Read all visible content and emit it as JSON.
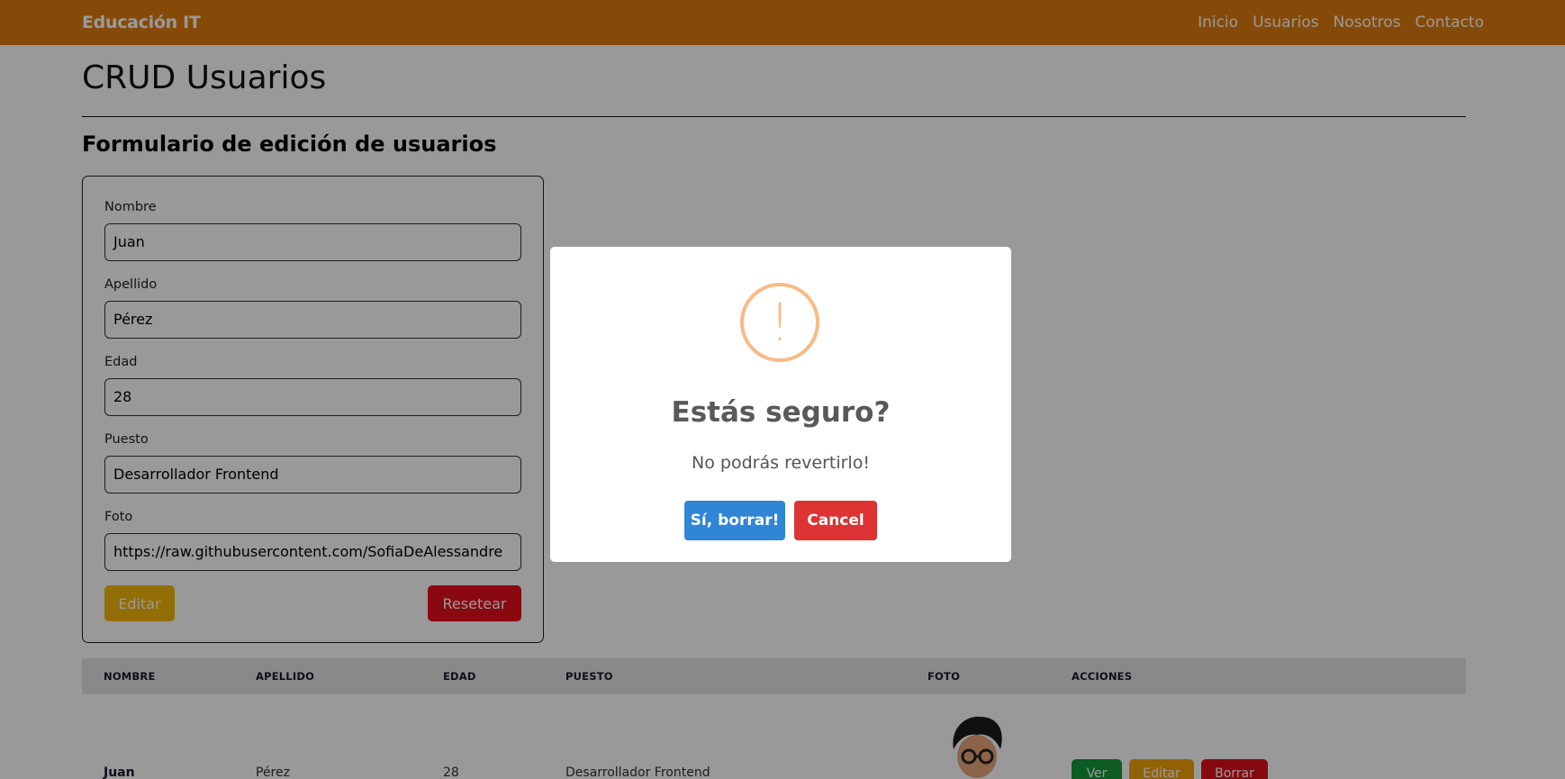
{
  "navbar": {
    "brand": "Educación IT",
    "links": [
      "Inicio",
      "Usuarios",
      "Nosotros",
      "Contacto"
    ]
  },
  "page": {
    "title": "CRUD Usuarios",
    "section_title": "Formulario de edición de usuarios"
  },
  "form": {
    "fields": [
      {
        "label": "Nombre",
        "value": "Juan"
      },
      {
        "label": "Apellido",
        "value": "Pérez"
      },
      {
        "label": "Edad",
        "value": "28"
      },
      {
        "label": "Puesto",
        "value": "Desarrollador Frontend"
      },
      {
        "label": "Foto",
        "value": "https://raw.githubusercontent.com/SofiaDeAlessandre"
      }
    ],
    "edit_label": "Editar",
    "reset_label": "Resetear"
  },
  "table": {
    "headers": [
      "NOMBRE",
      "APELLIDO",
      "EDAD",
      "PUESTO",
      "FOTO",
      "ACCIONES"
    ],
    "rows": [
      {
        "nombre": "Juan",
        "apellido": "Pérez",
        "edad": "28",
        "puesto": "Desarrollador Frontend"
      }
    ],
    "actions": {
      "ver": "Ver",
      "editar": "Editar",
      "borrar": "Borrar"
    }
  },
  "modal": {
    "icon": "!",
    "title": "Estás seguro?",
    "text": "No podrás revertirlo!",
    "confirm_label": "Sí, borrar!",
    "cancel_label": "Cancel"
  },
  "colors": {
    "navbar": "#e07c0e",
    "confirm": "#3085d6",
    "cancel": "#dd3333",
    "warning": "#f8bb86"
  }
}
